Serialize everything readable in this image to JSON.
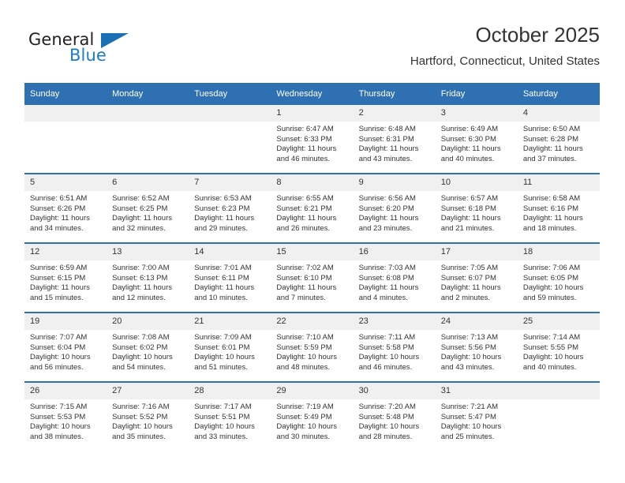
{
  "brand": {
    "name_top": "General",
    "name_bottom": "Blue",
    "triangle_color": "#1a6fb5",
    "blue_text_color": "#1b7dc4"
  },
  "header": {
    "title": "October 2025",
    "subtitle": "Hartford, Connecticut, United States"
  },
  "theme": {
    "header_blue": "#2e70b2",
    "daynum_band": "#f0f0f0"
  },
  "weekdays": [
    "Sunday",
    "Monday",
    "Tuesday",
    "Wednesday",
    "Thursday",
    "Friday",
    "Saturday"
  ],
  "labels": {
    "sunrise_prefix": "Sunrise:",
    "sunset_prefix": "Sunset:",
    "daylight_prefix": "Daylight:"
  },
  "weeks": [
    [
      {
        "day": "",
        "empty": true
      },
      {
        "day": "",
        "empty": true
      },
      {
        "day": "",
        "empty": true
      },
      {
        "day": "1",
        "sunrise": "Sunrise: 6:47 AM",
        "sunset": "Sunset: 6:33 PM",
        "daylight_l1": "Daylight: 11 hours",
        "daylight_l2": "and 46 minutes."
      },
      {
        "day": "2",
        "sunrise": "Sunrise: 6:48 AM",
        "sunset": "Sunset: 6:31 PM",
        "daylight_l1": "Daylight: 11 hours",
        "daylight_l2": "and 43 minutes."
      },
      {
        "day": "3",
        "sunrise": "Sunrise: 6:49 AM",
        "sunset": "Sunset: 6:30 PM",
        "daylight_l1": "Daylight: 11 hours",
        "daylight_l2": "and 40 minutes."
      },
      {
        "day": "4",
        "sunrise": "Sunrise: 6:50 AM",
        "sunset": "Sunset: 6:28 PM",
        "daylight_l1": "Daylight: 11 hours",
        "daylight_l2": "and 37 minutes."
      }
    ],
    [
      {
        "day": "5",
        "sunrise": "Sunrise: 6:51 AM",
        "sunset": "Sunset: 6:26 PM",
        "daylight_l1": "Daylight: 11 hours",
        "daylight_l2": "and 34 minutes."
      },
      {
        "day": "6",
        "sunrise": "Sunrise: 6:52 AM",
        "sunset": "Sunset: 6:25 PM",
        "daylight_l1": "Daylight: 11 hours",
        "daylight_l2": "and 32 minutes."
      },
      {
        "day": "7",
        "sunrise": "Sunrise: 6:53 AM",
        "sunset": "Sunset: 6:23 PM",
        "daylight_l1": "Daylight: 11 hours",
        "daylight_l2": "and 29 minutes."
      },
      {
        "day": "8",
        "sunrise": "Sunrise: 6:55 AM",
        "sunset": "Sunset: 6:21 PM",
        "daylight_l1": "Daylight: 11 hours",
        "daylight_l2": "and 26 minutes."
      },
      {
        "day": "9",
        "sunrise": "Sunrise: 6:56 AM",
        "sunset": "Sunset: 6:20 PM",
        "daylight_l1": "Daylight: 11 hours",
        "daylight_l2": "and 23 minutes."
      },
      {
        "day": "10",
        "sunrise": "Sunrise: 6:57 AM",
        "sunset": "Sunset: 6:18 PM",
        "daylight_l1": "Daylight: 11 hours",
        "daylight_l2": "and 21 minutes."
      },
      {
        "day": "11",
        "sunrise": "Sunrise: 6:58 AM",
        "sunset": "Sunset: 6:16 PM",
        "daylight_l1": "Daylight: 11 hours",
        "daylight_l2": "and 18 minutes."
      }
    ],
    [
      {
        "day": "12",
        "sunrise": "Sunrise: 6:59 AM",
        "sunset": "Sunset: 6:15 PM",
        "daylight_l1": "Daylight: 11 hours",
        "daylight_l2": "and 15 minutes."
      },
      {
        "day": "13",
        "sunrise": "Sunrise: 7:00 AM",
        "sunset": "Sunset: 6:13 PM",
        "daylight_l1": "Daylight: 11 hours",
        "daylight_l2": "and 12 minutes."
      },
      {
        "day": "14",
        "sunrise": "Sunrise: 7:01 AM",
        "sunset": "Sunset: 6:11 PM",
        "daylight_l1": "Daylight: 11 hours",
        "daylight_l2": "and 10 minutes."
      },
      {
        "day": "15",
        "sunrise": "Sunrise: 7:02 AM",
        "sunset": "Sunset: 6:10 PM",
        "daylight_l1": "Daylight: 11 hours",
        "daylight_l2": "and 7 minutes."
      },
      {
        "day": "16",
        "sunrise": "Sunrise: 7:03 AM",
        "sunset": "Sunset: 6:08 PM",
        "daylight_l1": "Daylight: 11 hours",
        "daylight_l2": "and 4 minutes."
      },
      {
        "day": "17",
        "sunrise": "Sunrise: 7:05 AM",
        "sunset": "Sunset: 6:07 PM",
        "daylight_l1": "Daylight: 11 hours",
        "daylight_l2": "and 2 minutes."
      },
      {
        "day": "18",
        "sunrise": "Sunrise: 7:06 AM",
        "sunset": "Sunset: 6:05 PM",
        "daylight_l1": "Daylight: 10 hours",
        "daylight_l2": "and 59 minutes."
      }
    ],
    [
      {
        "day": "19",
        "sunrise": "Sunrise: 7:07 AM",
        "sunset": "Sunset: 6:04 PM",
        "daylight_l1": "Daylight: 10 hours",
        "daylight_l2": "and 56 minutes."
      },
      {
        "day": "20",
        "sunrise": "Sunrise: 7:08 AM",
        "sunset": "Sunset: 6:02 PM",
        "daylight_l1": "Daylight: 10 hours",
        "daylight_l2": "and 54 minutes."
      },
      {
        "day": "21",
        "sunrise": "Sunrise: 7:09 AM",
        "sunset": "Sunset: 6:01 PM",
        "daylight_l1": "Daylight: 10 hours",
        "daylight_l2": "and 51 minutes."
      },
      {
        "day": "22",
        "sunrise": "Sunrise: 7:10 AM",
        "sunset": "Sunset: 5:59 PM",
        "daylight_l1": "Daylight: 10 hours",
        "daylight_l2": "and 48 minutes."
      },
      {
        "day": "23",
        "sunrise": "Sunrise: 7:11 AM",
        "sunset": "Sunset: 5:58 PM",
        "daylight_l1": "Daylight: 10 hours",
        "daylight_l2": "and 46 minutes."
      },
      {
        "day": "24",
        "sunrise": "Sunrise: 7:13 AM",
        "sunset": "Sunset: 5:56 PM",
        "daylight_l1": "Daylight: 10 hours",
        "daylight_l2": "and 43 minutes."
      },
      {
        "day": "25",
        "sunrise": "Sunrise: 7:14 AM",
        "sunset": "Sunset: 5:55 PM",
        "daylight_l1": "Daylight: 10 hours",
        "daylight_l2": "and 40 minutes."
      }
    ],
    [
      {
        "day": "26",
        "sunrise": "Sunrise: 7:15 AM",
        "sunset": "Sunset: 5:53 PM",
        "daylight_l1": "Daylight: 10 hours",
        "daylight_l2": "and 38 minutes."
      },
      {
        "day": "27",
        "sunrise": "Sunrise: 7:16 AM",
        "sunset": "Sunset: 5:52 PM",
        "daylight_l1": "Daylight: 10 hours",
        "daylight_l2": "and 35 minutes."
      },
      {
        "day": "28",
        "sunrise": "Sunrise: 7:17 AM",
        "sunset": "Sunset: 5:51 PM",
        "daylight_l1": "Daylight: 10 hours",
        "daylight_l2": "and 33 minutes."
      },
      {
        "day": "29",
        "sunrise": "Sunrise: 7:19 AM",
        "sunset": "Sunset: 5:49 PM",
        "daylight_l1": "Daylight: 10 hours",
        "daylight_l2": "and 30 minutes."
      },
      {
        "day": "30",
        "sunrise": "Sunrise: 7:20 AM",
        "sunset": "Sunset: 5:48 PM",
        "daylight_l1": "Daylight: 10 hours",
        "daylight_l2": "and 28 minutes."
      },
      {
        "day": "31",
        "sunrise": "Sunrise: 7:21 AM",
        "sunset": "Sunset: 5:47 PM",
        "daylight_l1": "Daylight: 10 hours",
        "daylight_l2": "and 25 minutes."
      },
      {
        "day": "",
        "empty": true
      }
    ]
  ]
}
